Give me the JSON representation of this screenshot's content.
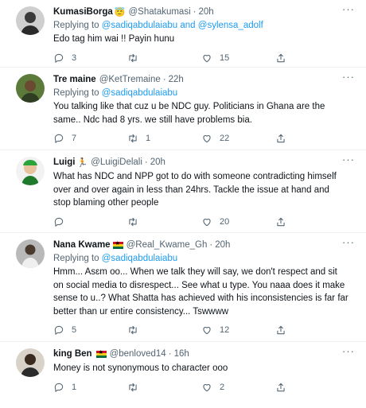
{
  "tweets": [
    {
      "name": "KumasiBorga",
      "name_emoji": "😇",
      "handle": "@Shatakumasi",
      "time": "20h",
      "reply_prefix": "Replying to",
      "reply_to": "@sadiqabdulaiabu and @sylensa_adolf",
      "text": "Edo tag him wai !! Payin hunu",
      "replies": "3",
      "retweets": "",
      "likes": "15"
    },
    {
      "name": "Tre maine",
      "handle": "@KetTremaine",
      "time": "22h",
      "reply_prefix": "Replying to",
      "reply_to": "@sadiqabdulaiabu",
      "text": "You talking like that cuz u be NDC guy. Politicians in Ghana are the same.. Ndc had 8 yrs. we still have problems bia.",
      "replies": "7",
      "retweets": "1",
      "likes": "22"
    },
    {
      "name": "Luigi",
      "name_emoji": "🏃",
      "handle": "@LuigiDelali",
      "time": "20h",
      "text": "What has NDC and NPP got to do with someone contradicting himself over and over again in less than 24hrs. Tackle the issue at hand and stop blaming other people",
      "replies": "",
      "retweets": "",
      "likes": "20"
    },
    {
      "name": "Nana Kwame",
      "handle": "@Real_Kwame_Gh",
      "time": "20h",
      "reply_prefix": "Replying to",
      "reply_to": "@sadiqabdulaiabu",
      "text": "Hmm... Asɛm oo... When we talk they will say, we don't respect and sit on social media to disrespect... See what u type. You naaa does it make sense to u..? What Shatta has achieved with his inconsistencies is far far better than ur entire consistency... Tswwww",
      "replies": "5",
      "retweets": "",
      "likes": "12"
    },
    {
      "name": "king Ben",
      "handle": "@benloved14",
      "time": "16h",
      "text": "Money is not synonymous to character ooo",
      "replies": "1",
      "retweets": "",
      "likes": "2"
    }
  ],
  "icons": {
    "more": "more-icon",
    "reply": "reply-icon",
    "retweet": "retweet-icon",
    "like": "like-icon",
    "share": "share-icon"
  },
  "colors": {
    "link": "#1d9bf0",
    "secondary_text": "#536471",
    "text": "#0f1419",
    "divider": "#eff3f4"
  }
}
